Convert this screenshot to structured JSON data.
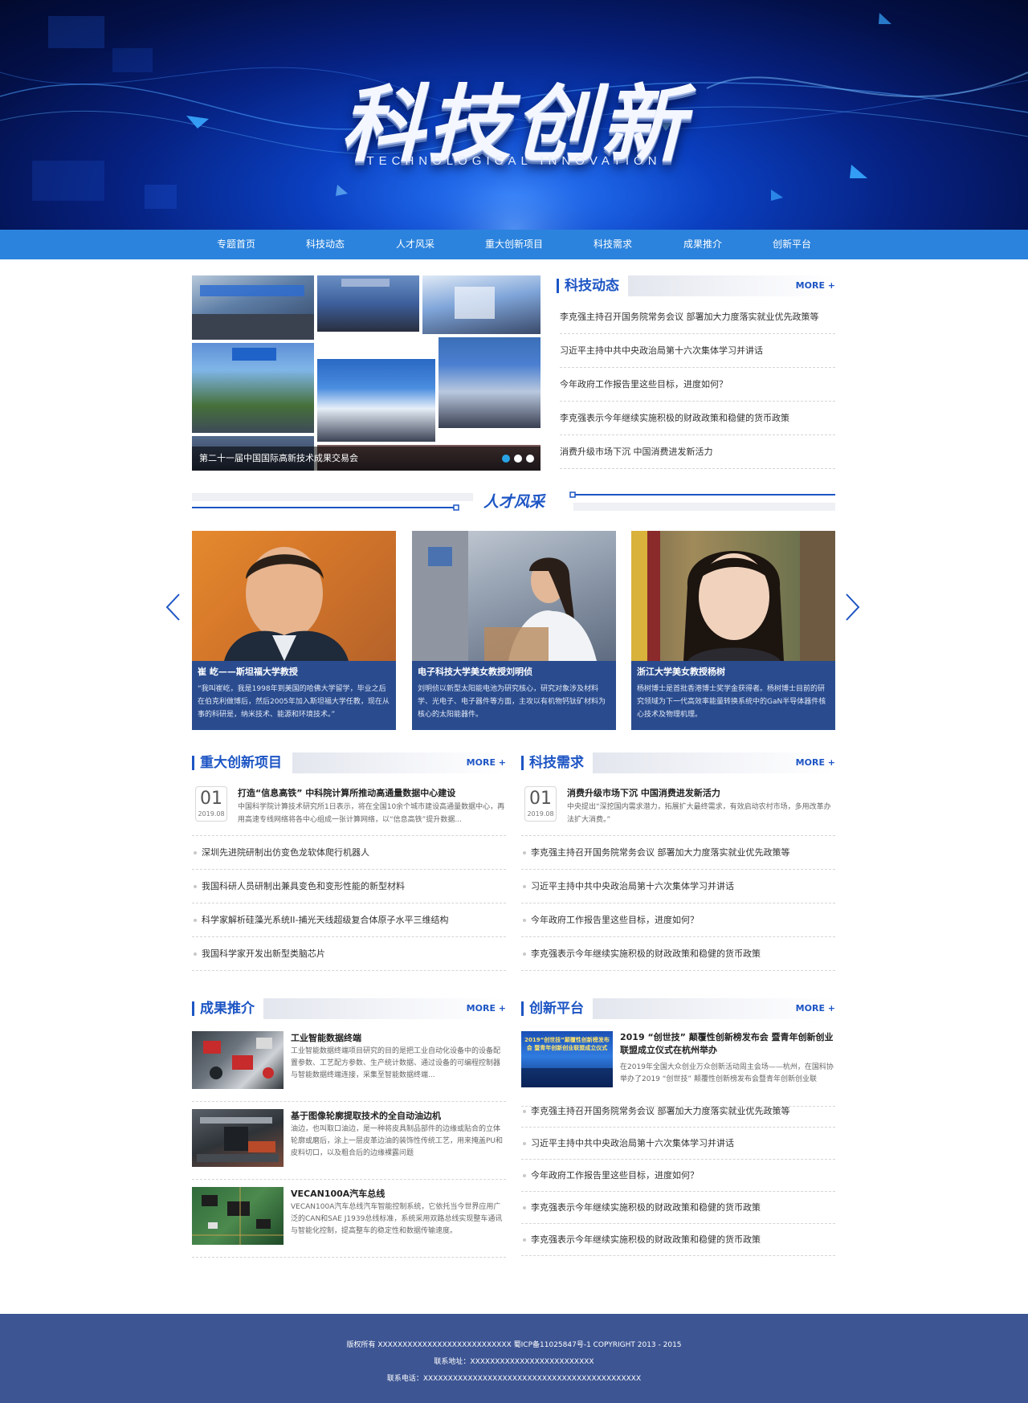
{
  "banner": {
    "title": "科技创新",
    "subtitle": "TECHNOLOGICAL INNOVATION"
  },
  "nav": {
    "items": [
      "专题首页",
      "科技动态",
      "人才风采",
      "重大创新项目",
      "科技需求",
      "成果推介",
      "创新平台"
    ]
  },
  "slideshow": {
    "caption": "第二十一届中国国际高新技术成果交易会",
    "dot_count": 3,
    "active_dot": 1
  },
  "news": {
    "title": "科技动态",
    "more": "MORE +",
    "items": [
      "李克强主持召开国务院常务会议 部署加大力度落实就业优先政策等",
      "习近平主持中共中央政治局第十六次集体学习并讲话",
      "今年政府工作报告里这些目标，进度如何？",
      "李克强表示今年继续实施积极的财政政策和稳健的货币政策",
      "消费升级市场下沉 中国消费进发新活力"
    ]
  },
  "talent": {
    "title": "人才风采",
    "cards": [
      {
        "name": "崔 屹——斯坦福大学教授",
        "desc": "“我叫崔屹，我是1998年到美国的哈佛大学留学，毕业之后在伯克利做博后，然后2005年加入斯坦福大学任教，现在从事的科研是，纳米技术、能源和环境技术。”"
      },
      {
        "name": "电子科技大学美女教授刘明侦",
        "desc": "刘明侦以新型太阳能电池为研究核心，研究对象涉及材料学、光电子、电子器件等方面，主攻以有机物钙钛矿材料为核心的太阳能器件。"
      },
      {
        "name": "浙江大学美女教授杨树",
        "desc": "杨树博士是首批香港博士奖学金获得者。杨树博士目前的研究领域为下一代高效率能量转换系统中的GaN半导体器件核心技术及物理机理。"
      }
    ]
  },
  "projects": {
    "title": "重大创新项目",
    "more": "MORE +",
    "featured": {
      "num": "01",
      "date": "2019.08",
      "title": "打造“信息高铁” 中科院计算所推动高通量数据中心建设",
      "desc": "中国科学院计算技术研究所1日表示，将在全国10余个城市建设高通量数据中心，再用高速专线网络将各中心组成一张计算网络，以“信息高铁”提升数据..."
    },
    "items": [
      "深圳先进院研制出仿变色龙软体爬行机器人",
      "我国科研人员研制出兼具变色和变形性能的新型材料",
      "科学家解析硅藻光系统II-捕光天线超级复合体原子水平三维结构",
      "我国科学家开发出新型类脑芯片"
    ]
  },
  "demand": {
    "title": "科技需求",
    "more": "MORE +",
    "featured": {
      "num": "01",
      "date": "2019.08",
      "title": "消费升级市场下沉 中国消费进发新活力",
      "desc": "中央提出“深挖国内需求潜力，拓展扩大最终需求，有效启动农村市场，多用改革办法扩大消费。”"
    },
    "items": [
      "李克强主持召开国务院常务会议 部署加大力度落实就业优先政策等",
      "习近平主持中共中央政治局第十六次集体学习并讲话",
      "今年政府工作报告里这些目标，进度如何？",
      "李克强表示今年继续实施积极的财政政策和稳健的货币政策"
    ]
  },
  "results": {
    "title": "成果推介",
    "more": "MORE +",
    "items": [
      {
        "title": "工业智能数据终端",
        "desc": "工业智能数据终端项目研究的目的是把工业自动化设备中的设备配置参数、工艺配方参数、生产统计数据、通过设备的可编程控制器与智能数据终端连接，采集至智能数据终端..."
      },
      {
        "title": "基于图像轮廓提取技术的全自动油边机",
        "desc": "油边，也叫取口油边，是一种将皮具制品部件的边缘或贴合的立体轮廓或磨后，涂上一层皮革边油的装饰性传统工艺，用来掩盖PU和皮料切口，以及粗合后的边缘裸露问题"
      },
      {
        "title": "VECAN100A汽车总线",
        "desc": "VECAN100A汽车总线汽车智能控制系统，它依托当今世界应用广泛的CAN和SAE J1939总线标准，系统采用双路总线实现整车通讯与智能化控制，提高整车的稳定性和数据传输速度。"
      }
    ]
  },
  "platform": {
    "title": "创新平台",
    "more": "MORE +",
    "featured": {
      "image_text": "2019“创世技”颠覆性创新榜发布会 暨青年创新创业联盟成立仪式",
      "title": "2019 “创世技” 颠覆性创新榜发布会 暨青年创新创业联盟成立仪式在杭州举办",
      "desc": "在2019年全国大众创业万众创新活动周主会场——杭州，在国科协举办了2019 “创世技” 颠覆性创新榜发布会暨青年创新创业联"
    },
    "items": [
      "李克强主持召开国务院常务会议 部署加大力度落实就业优先政策等",
      "习近平主持中共中央政治局第十六次集体学习并讲话",
      "今年政府工作报告里这些目标，进度如何？",
      "李克强表示今年继续实施积极的财政政策和稳健的货币政策",
      "李克强表示今年继续实施积极的财政政策和稳健的货币政策"
    ]
  },
  "footer": {
    "copyright": "版权所有 XXXXXXXXXXXXXXXXXXXXXXXXXXX      蜀ICP备11025847号-1 COPYRIGHT 2013 - 2015",
    "address": "联系地址：XXXXXXXXXXXXXXXXXXXXXXXXX",
    "phone": "联系电话：XXXXXXXXXXXXXXXXXXXXXXXXXXXXXXXXXXXXXXXXXXXX"
  },
  "colors": {
    "brand_blue": "#1d55c4",
    "nav_blue": "#2b83dd",
    "card_blue": "#2a4c8f",
    "footer_blue": "#3d5593"
  }
}
